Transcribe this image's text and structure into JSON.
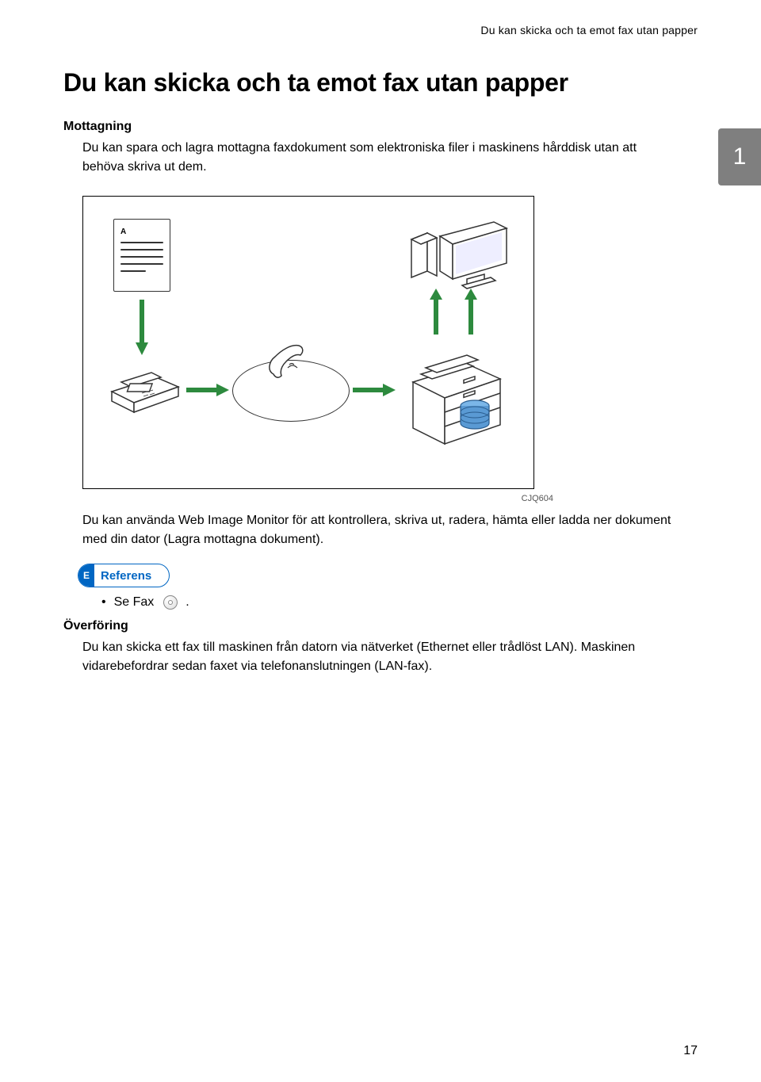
{
  "header": {
    "running_title": "Du kan skicka och ta emot fax utan papper"
  },
  "chapter": {
    "number": "1"
  },
  "title": "Du kan skicka och ta emot fax utan papper",
  "section_mottagning": {
    "heading": "Mottagning",
    "body": "Du kan spara och lagra mottagna faxdokument som elektroniska filer i maskinens hårddisk utan att behöva skriva ut dem."
  },
  "figure": {
    "doc_letter": "A",
    "code": "CJQ604"
  },
  "after_figure": {
    "body": "Du kan använda Web Image Monitor för att kontrollera, skriva ut, radera, hämta eller ladda ner dokument med din dator (Lagra mottagna dokument)."
  },
  "referens": {
    "tag": "E",
    "label": "Referens",
    "bullet_prefix": "Se Fax",
    "bullet_suffix": "."
  },
  "section_overforing": {
    "heading": "Överföring",
    "body": "Du kan skicka ett fax till maskinen från datorn via nätverket (Ethernet eller trådlöst LAN). Maskinen vidarebefordrar sedan faxet via telefonanslutningen (LAN-fax)."
  },
  "page_number": "17"
}
